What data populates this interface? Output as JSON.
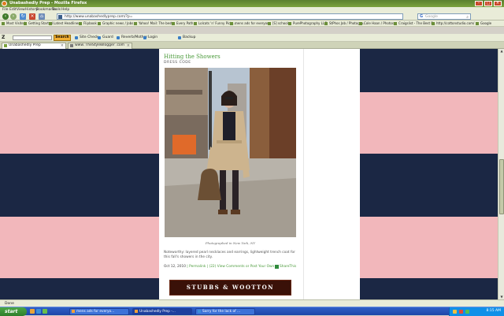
{
  "window": {
    "title": "Unabashedly Prep - Mozilla Firefox"
  },
  "menu": [
    "File",
    "Edit",
    "View",
    "History",
    "Bookmarks",
    "Tools",
    "Help"
  ],
  "nav": {
    "url": "http://www.unabashedlyprep.com/?p=",
    "search_placeholder": "Google"
  },
  "bookmarks": [
    "Most Visited",
    "Getting Started",
    "Latest Headlines",
    "Flipbook",
    "Graphic news / Jobs",
    "Yahoo! Mail: The best",
    "Every Path",
    "Lolcats 'n' Funny Pictu...",
    "mens ads for everyone",
    "[S] school",
    "PurePhotography LLC",
    "StPhos Job / Photogra...",
    "Cole Haan / Photos",
    "Craigslist - The Best F...",
    "http://cottonstudio.com/",
    "Google"
  ],
  "toolbar2": {
    "logo": "Z",
    "search_btn": "Search",
    "items": [
      "Site Check",
      "Guard",
      "Reverb/Mother",
      "Login",
      "Backup"
    ]
  },
  "tabs": [
    {
      "label": "Unabashedly Prep"
    },
    {
      "label": "www. TheStyleBlogger .com"
    }
  ],
  "post": {
    "title": "Hitting the Showers",
    "subtitle": "DRESS CODE",
    "caption": "Photographed in New York, NY",
    "body": "Noteworthy: layered pearl necklaces and earrings, lightweight trench coat for this fall's showers in the city.",
    "date": "Oct 12, 2010",
    "permalink": "Permalink",
    "comments": "(22)",
    "view_comments": "View Comments or Post Your Own",
    "share": "ShareThis",
    "ad": "STUBBS & WOOTTON"
  },
  "status": "Done",
  "taskbar": {
    "start": "start",
    "tasks": [
      "mens ads for everyo...",
      "Unabashedly Prep -...",
      "Sorry for the lack of ..."
    ],
    "clock": "8:15 AM"
  },
  "colors": {
    "navy": "#1b2744",
    "pink": "#f2b7bb",
    "accent_green": "#4a9a3a"
  }
}
